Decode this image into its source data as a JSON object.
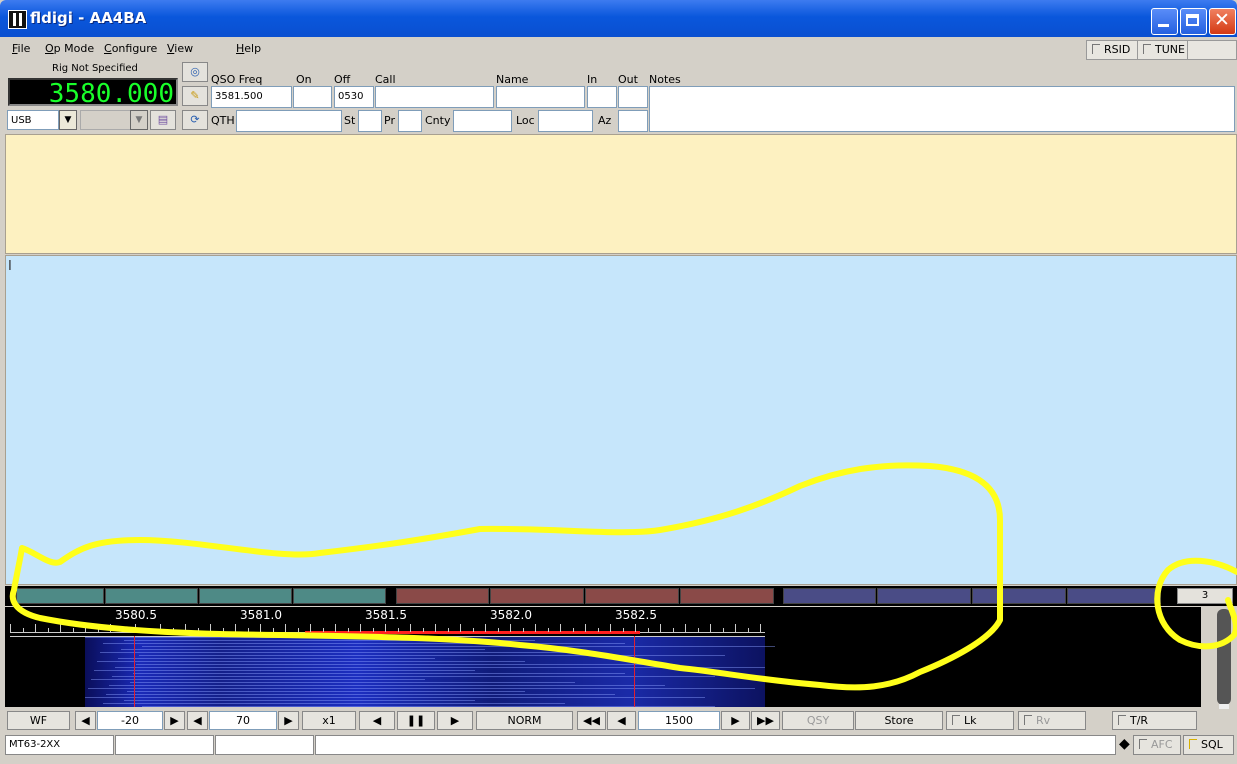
{
  "window": {
    "title": "fldigi - AA4BA"
  },
  "menu": {
    "items": [
      {
        "label": "File",
        "accel": "F",
        "rest": "ile"
      },
      {
        "label": "Op Mode",
        "accel": "O",
        "rest": "p Mode"
      },
      {
        "label": "Configure",
        "accel": "C",
        "rest": "onfigure"
      },
      {
        "label": "View",
        "accel": "V",
        "rest": "iew"
      },
      {
        "label": "Help",
        "accel": "H",
        "rest": "elp"
      }
    ],
    "rsid": "RSID",
    "tune": "TUNE"
  },
  "rig": {
    "name": "Rig Not Specified",
    "frequency": "3580.000",
    "mode": "USB"
  },
  "log": {
    "labels": {
      "qso_freq": "QSO Freq",
      "on": "On",
      "off": "Off",
      "call": "Call",
      "name": "Name",
      "in": "In",
      "out": "Out",
      "notes": "Notes",
      "qth": "QTH",
      "st": "St",
      "pr": "Pr",
      "cnty": "Cnty",
      "loc": "Loc",
      "az": "Az"
    },
    "qso_freq": "3581.500",
    "on": "",
    "off": "0530",
    "call": "",
    "name": "",
    "in": "",
    "out": "",
    "notes": ""
  },
  "macros": {
    "set": "3"
  },
  "waterfall": {
    "scale": [
      "3580.5",
      "3581.0",
      "3581.5",
      "3582.0",
      "3582.5"
    ]
  },
  "controls": {
    "wf": "WF",
    "ref_level": "-20",
    "range": "70",
    "zoom": "x1",
    "norm": "NORM",
    "freq": "1500",
    "qsy": "QSY",
    "store": "Store",
    "lk": "Lk",
    "rv": "Rv",
    "tr": "T/R"
  },
  "status": {
    "mode": "MT63-2XX",
    "afc": "AFC",
    "sql": "SQL"
  },
  "colors": {
    "title_bar": "#0a57dc",
    "rx_pane": "#fdf1c1",
    "tx_pane": "#c6e6fb",
    "freq_digits": "#19ff2a",
    "annotation": "#ffff1a"
  }
}
